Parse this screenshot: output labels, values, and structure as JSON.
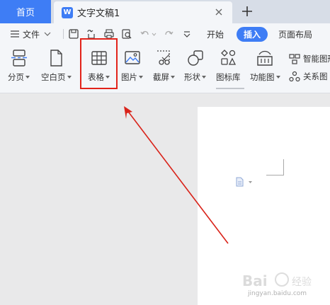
{
  "tabs": {
    "home": "首页",
    "document": "文字文稿1",
    "doc_badge": "W"
  },
  "toolbar": {
    "file_menu": "文件",
    "ribbon_tabs": [
      "开始",
      "插入",
      "页面布局"
    ],
    "active_tab": "插入",
    "buttons": {
      "page_break": "分页",
      "blank_page": "空白页",
      "table": "表格",
      "picture": "图片",
      "screenshot": "截屏",
      "shape": "形状",
      "icon_library": "图标库",
      "function_chart": "功能图",
      "smart_graphic": "智能图形",
      "relation_chart": "关系图"
    }
  },
  "watermark": {
    "brand": "Bai",
    "brand2": "经验",
    "url": "jingyan.baidu.com"
  },
  "colors": {
    "accent": "#3e7df5",
    "highlight": "#e2231a",
    "arrow": "#d9231a"
  }
}
